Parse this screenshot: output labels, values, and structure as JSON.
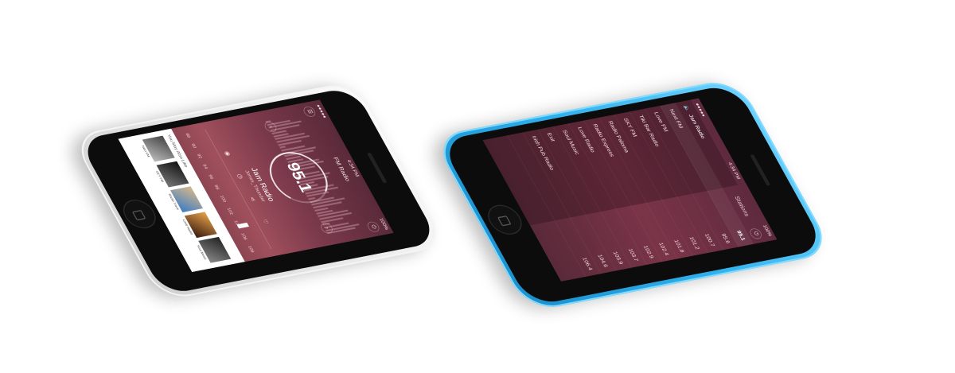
{
  "white_phone": {
    "status": {
      "time": "4:34 PM",
      "battery": "100%"
    },
    "nav": {
      "title": "FM Radio",
      "menu_icon": "menu-icon",
      "power_icon": "power-icon"
    },
    "now_playing": {
      "frequency": "95.1",
      "station": "Jam Radio",
      "artist": "Jones_Thunder"
    },
    "dial_labels": [
      "88",
      "90",
      "92",
      "94",
      "96",
      "98",
      "100",
      "102",
      "104",
      "106",
      "108"
    ],
    "you_may_also_like": {
      "title": "You May Also Like",
      "items": [
        {
          "caption": "Next FM"
        },
        {
          "caption": "SKY FM"
        },
        {
          "caption": "Radio Track"
        },
        {
          "caption": "Love Radio"
        },
        {
          "caption": "Soul Music"
        }
      ]
    }
  },
  "blue_phone": {
    "status": {
      "time": "4:34 PM",
      "battery": "100%"
    },
    "header": {
      "current": "Jam Radio",
      "section_title": "Stations"
    },
    "stations": [
      {
        "name": "Next FM",
        "freq": "95.1",
        "active": true
      },
      {
        "name": "Love FM",
        "freq": "95.6"
      },
      {
        "name": "Tiki Bar Radio",
        "freq": "100.7"
      },
      {
        "name": "SKY FM",
        "freq": "101.2"
      },
      {
        "name": "Radio Paloma",
        "freq": "101.8"
      },
      {
        "name": "Radio Express",
        "freq": "102.4"
      },
      {
        "name": "Love Radio",
        "freq": "102.9"
      },
      {
        "name": "Soul Music",
        "freq": "103.7"
      },
      {
        "name": "Exit",
        "freq": "103.9"
      },
      {
        "name": "Irish Pub Radio",
        "freq": "104.6"
      },
      {
        "name": "",
        "freq": "106.4"
      }
    ]
  }
}
